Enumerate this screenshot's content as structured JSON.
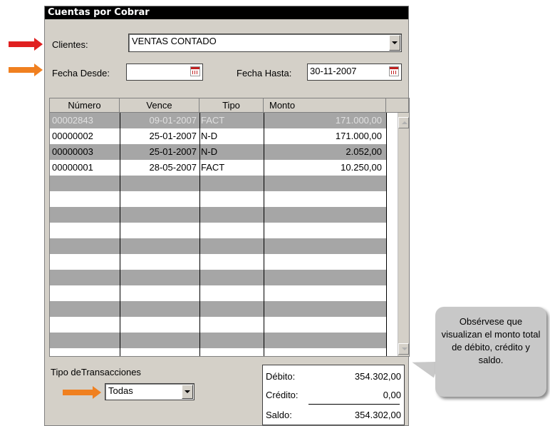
{
  "window": {
    "title": "Cuentas por Cobrar"
  },
  "filters": {
    "clientes_label": "Clientes:",
    "clientes_value": "VENTAS CONTADO",
    "fecha_desde_label": "Fecha Desde:",
    "fecha_desde_value": "",
    "fecha_hasta_label": "Fecha Hasta:",
    "fecha_hasta_value": "30-11-2007"
  },
  "table": {
    "columns": [
      "Número",
      "Vence",
      "Tipo",
      "Monto"
    ],
    "rows": [
      {
        "numero": "00002843",
        "vence": "09-01-2007",
        "tipo": "FACT",
        "monto": "171.000,00"
      },
      {
        "numero": "00000002",
        "vence": "25-01-2007",
        "tipo": "N-D",
        "monto": "171.000,00"
      },
      {
        "numero": "00000003",
        "vence": "25-01-2007",
        "tipo": "N-D",
        "monto": "2.052,00"
      },
      {
        "numero": "00000001",
        "vence": "28-05-2007",
        "tipo": "FACT",
        "monto": "10.250,00"
      }
    ]
  },
  "tipo_transacciones": {
    "label": "Tipo deTransacciones",
    "value": "Todas"
  },
  "totals": {
    "debito_label": "Débito:",
    "debito_value": "354.302,00",
    "credito_label": "Crédito:",
    "credito_value": "0,00",
    "saldo_label": "Saldo:",
    "saldo_value": "354.302,00"
  },
  "callout": {
    "text": "Obsérvese que visualizan el monto total de débito, crédito y saldo."
  },
  "colors": {
    "arrow_red": "#e02020",
    "arrow_orange": "#f08020",
    "row_gray": "#a6a6a6"
  }
}
